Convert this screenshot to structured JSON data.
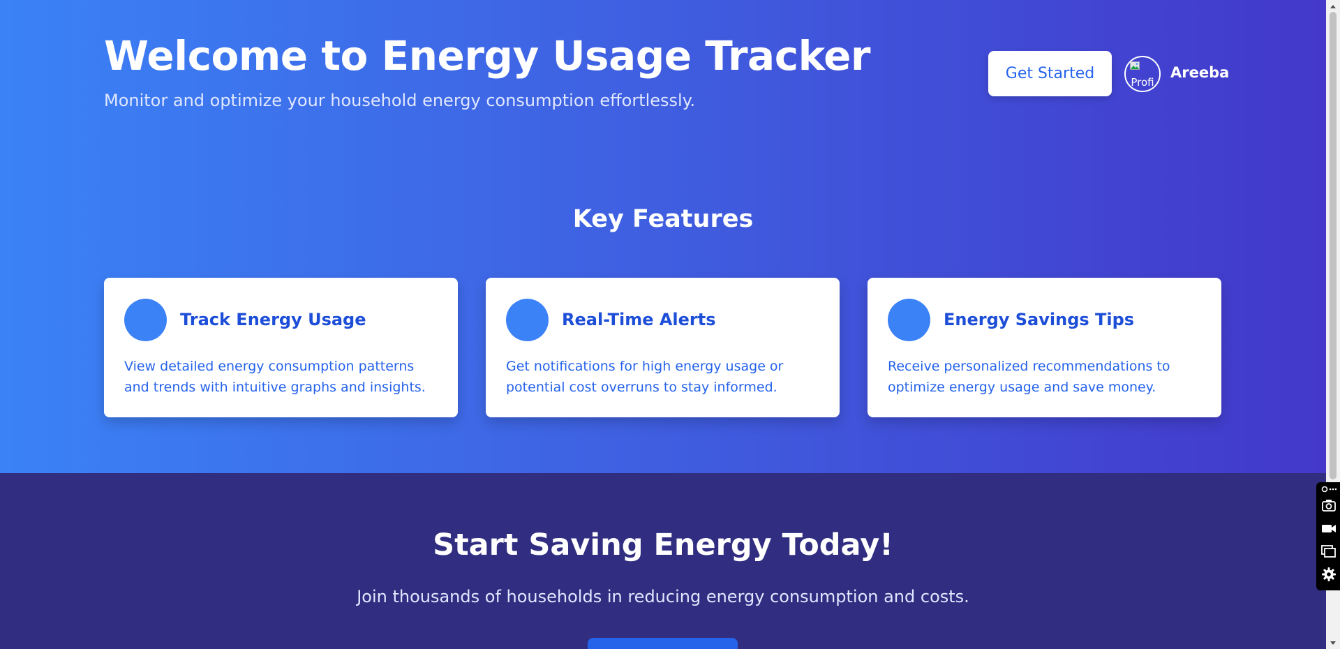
{
  "hero": {
    "title": "Welcome to Energy Usage Tracker",
    "subtitle": "Monitor and optimize your household energy consumption effortlessly.",
    "cta_label": "Get Started",
    "avatar_alt": "Profi",
    "username": "Areeba"
  },
  "features": {
    "heading": "Key Features",
    "items": [
      {
        "title": "Track Energy Usage",
        "description": "View detailed energy consumption patterns and trends with intuitive graphs and insights.",
        "icon": "feature-circle-icon"
      },
      {
        "title": "Real-Time Alerts",
        "description": "Get notifications for high energy usage or potential cost overruns to stay informed.",
        "icon": "feature-circle-icon"
      },
      {
        "title": "Energy Savings Tips",
        "description": "Receive personalized recommendations to optimize energy usage and save money.",
        "icon": "feature-circle-icon"
      }
    ]
  },
  "cta": {
    "title": "Start Saving Energy Today!",
    "subtitle": "Join thousands of households in reducing energy consumption and costs."
  },
  "extension_panel": {
    "tools": [
      "link-icon",
      "camera-icon",
      "video-icon",
      "window-icon",
      "gear-icon"
    ]
  },
  "colors": {
    "gradient_start": "#3b82f6",
    "gradient_end": "#4338ca",
    "cta_background": "#312e81",
    "accent": "#2563eb",
    "card_text": "#1d4ed8"
  }
}
